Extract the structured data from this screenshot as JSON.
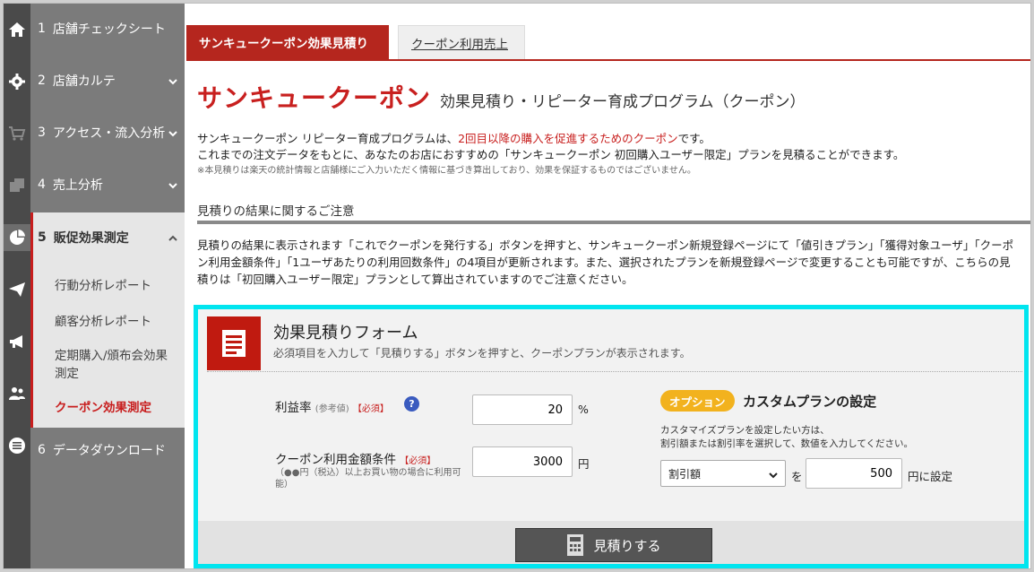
{
  "sidebar": {
    "items": [
      {
        "num": "1",
        "label": "店舗チェックシート"
      },
      {
        "num": "2",
        "label": "店舗カルテ"
      },
      {
        "num": "3",
        "label": "アクセス・流入分析"
      },
      {
        "num": "4",
        "label": "売上分析"
      },
      {
        "num": "5",
        "label": "販促効果測定"
      },
      {
        "num": "6",
        "label": "データダウンロード"
      }
    ],
    "sub_items": [
      "行動分析レポート",
      "顧客分析レポート",
      "定期購入/頒布会効果測定",
      "クーポン効果測定"
    ]
  },
  "tabs": [
    "サンキュークーポン効果見積り",
    "クーポン利用売上"
  ],
  "page": {
    "title": "サンキュークーポン",
    "subtitle": "効果見積り・リピーター育成プログラム（クーポン）",
    "intro_1a": "サンキュークーポン リピーター育成プログラムは、",
    "intro_1b": "2回目以降の購入を促進するためのクーポン",
    "intro_1c": "です。",
    "intro_2": "これまでの注文データをもとに、あなたのお店におすすめの「サンキュークーポン 初回購入ユーザー限定」プランを見積ることができます。",
    "intro_note": "※本見積りは楽天の統計情報と店舗様にご入力いただく情報に基づき算出しており、効果を保証するものではございません。",
    "section_title": "見積りの結果に関するご注意",
    "notice": "見積りの結果に表示されます「これでクーポンを発行する」ボタンを押すと、サンキュークーポン新規登録ページにて「値引きプラン」「獲得対象ユーザ」「クーポン利用金額条件」「1ユーザあたりの利用回数条件」の4項目が更新されます。また、選択されたプランを新規登録ページで変更することも可能ですが、こちらの見積りは「初回購入ユーザー限定」プランとして算出されていますのでご注意ください。"
  },
  "form": {
    "title": "効果見積りフォーム",
    "desc": "必須項目を入力して「見積りする」ボタンを押すと、クーポンプランが表示されます。",
    "profit_label": "利益率",
    "profit_ref": "(参考値)",
    "required": "【必須】",
    "profit_value": "20",
    "profit_unit": "%",
    "amount_label": "クーポン利用金額条件",
    "amount_note": "（●●円（税込）以上お買い物の場合に利用可能）",
    "amount_value": "3000",
    "amount_unit": "円",
    "help": "?",
    "option_badge": "オプション",
    "option_title": "カスタムプランの設定",
    "option_desc_1": "カスタマイズプランを設定したい方は、",
    "option_desc_2": "割引額または割引率を選択して、数値を入力してください。",
    "select_value": "割引額",
    "wo": "を",
    "custom_value": "500",
    "custom_unit": "円に設定",
    "submit": "見積りする"
  }
}
